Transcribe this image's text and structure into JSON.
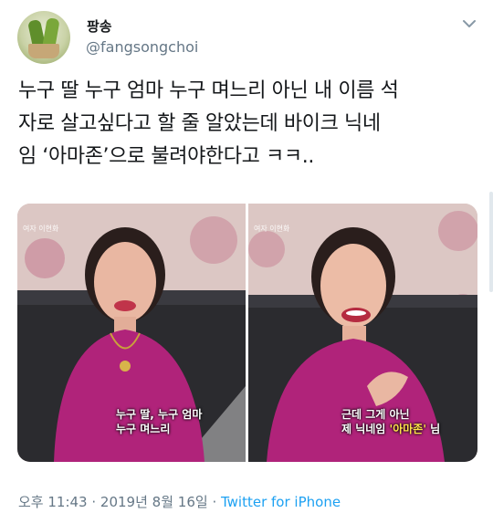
{
  "user": {
    "display_name": "팡송",
    "handle": "@fangsongchoi"
  },
  "tweet": {
    "lines": [
      "누구 딸 누구 엄마 누구 며느리 아닌 내 이름 석",
      "자로 살고싶다고 할 줄 알았는데 바이크 닉네",
      "임 ‘아마존’으로 불려야한다고 ㅋㅋ.."
    ]
  },
  "photos": [
    {
      "tag": "여자 이현화",
      "caption_line1": "누구 딸, 누구 엄마",
      "caption_line2": "누구 며느리"
    },
    {
      "tag": "여자 이현화",
      "caption_line1": "근데 그게 아닌",
      "caption_line2_prefix": "제 닉네임 ",
      "caption_line2_highlight": "'아마존'",
      "caption_line2_suffix": " 님"
    }
  ],
  "meta": {
    "time": "오후 11:43",
    "separator": " · ",
    "date": "2019년 8월 16일",
    "separator2": " · ",
    "source": "Twitter for iPhone"
  },
  "colors": {
    "text": "#14171a",
    "secondary": "#657786",
    "link": "#1da1f2",
    "shirt": "#b0237a"
  }
}
